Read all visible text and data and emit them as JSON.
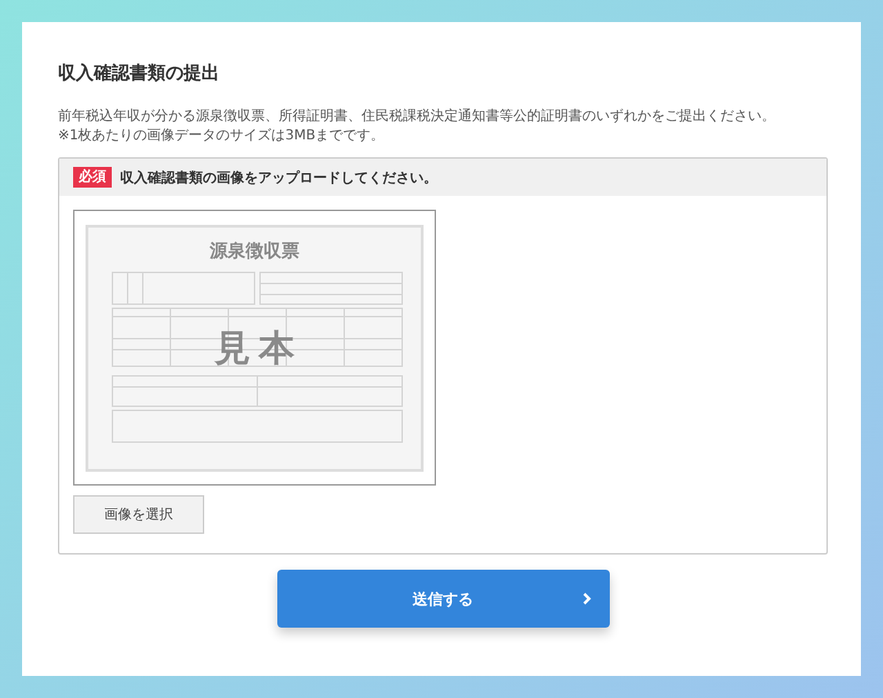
{
  "title": "収入確認書類の提出",
  "notes": [
    "前年税込年収が分かる源泉徴収票、所得証明書、住民税課税決定通知書等公的証明書のいずれかをご提出ください。",
    "※1枚あたりの画像データのサイズは3MBまでです。"
  ],
  "upload": {
    "required_badge": "必須",
    "instruction": "収入確認書類の画像をアップロードしてください。",
    "sample": {
      "title": "源泉徴収票",
      "watermark": "見本"
    },
    "select_button": "画像を選択"
  },
  "submit_button": {
    "label": "送信する"
  }
}
